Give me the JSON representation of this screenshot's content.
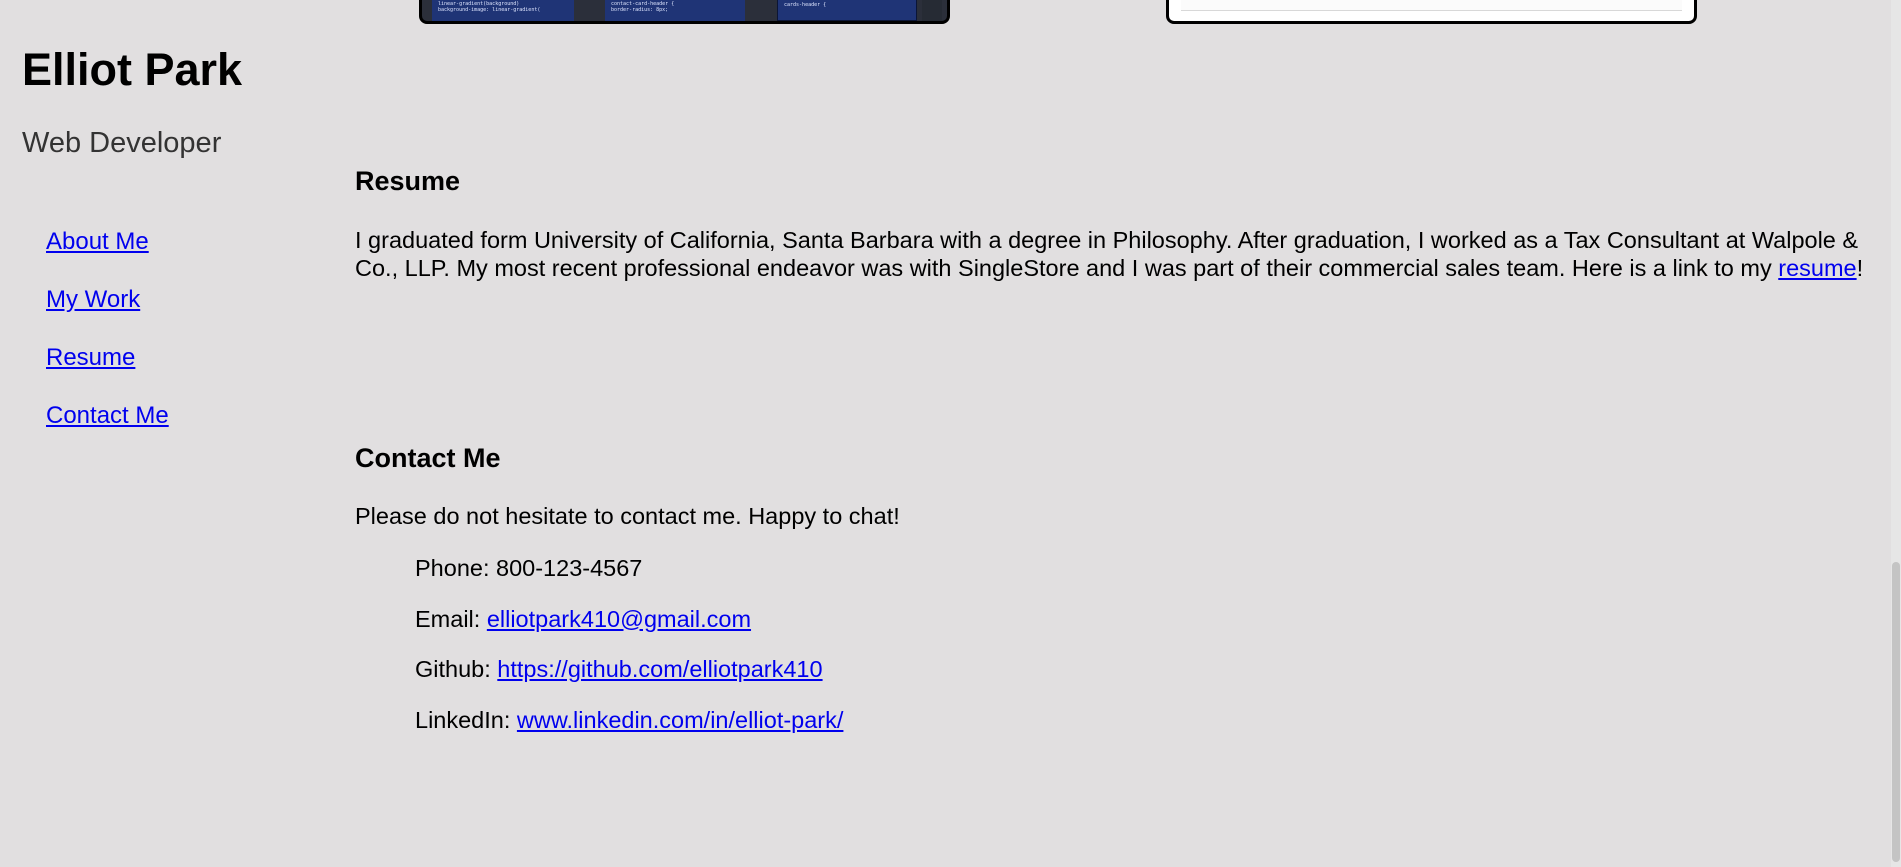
{
  "header": {
    "name": "Elliot Park",
    "role": "Web Developer"
  },
  "nav": {
    "items": [
      {
        "label": "About Me"
      },
      {
        "label": "My Work"
      },
      {
        "label": "Resume"
      },
      {
        "label": "Contact Me"
      }
    ]
  },
  "thumbnails": {
    "left_panel_1_line_1": "linear-gradient(background)",
    "left_panel_1_line_2": "background-image: linear-gradient(",
    "left_panel_2_line_1": "contact-card-header {",
    "left_panel_2_line_2": "border-radius: 8px;",
    "left_panel_3_line_1": "cards-header {"
  },
  "resume": {
    "title": "Resume",
    "text_before_link": "I graduated form University of California, Santa Barbara with a degree in Philosophy. After graduation, I worked as a Tax Consultant at Walpole & Co., LLP. My most recent professional endeavor was with SingleStore and I was part of their commercial sales team. Here is a link to my ",
    "link_text": "resume",
    "text_after_link": "!"
  },
  "contact": {
    "title": "Contact Me",
    "intro": "Please do not hesitate to contact me. Happy to chat!",
    "phone_label": "Phone: ",
    "phone_value": "800-123-4567",
    "email_label": "Email: ",
    "email_value": "elliotpark410@gmail.com",
    "github_label": "Github: ",
    "github_value": "https://github.com/elliotpark410",
    "linkedin_label": "LinkedIn: ",
    "linkedin_value": "www.linkedin.com/in/elliot-park/"
  }
}
